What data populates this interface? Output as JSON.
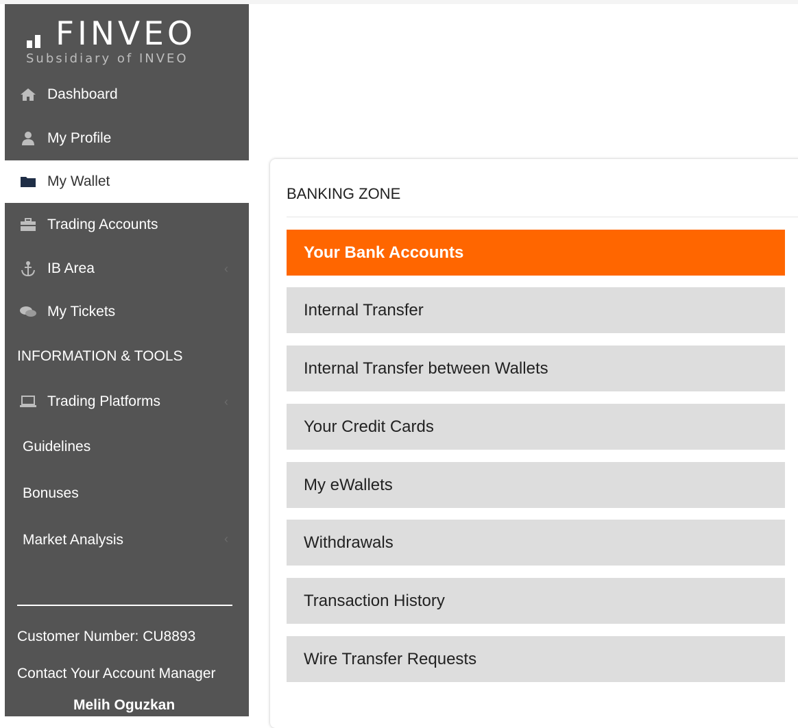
{
  "brand": {
    "name": "FINVEO",
    "tagline": "Subsidiary of INVEO"
  },
  "sidebar": {
    "items": [
      {
        "label": "Dashboard",
        "icon": "home-icon"
      },
      {
        "label": "My Profile",
        "icon": "user-icon"
      },
      {
        "label": "My Wallet",
        "icon": "folder-icon",
        "active": true
      },
      {
        "label": "Trading Accounts",
        "icon": "briefcase-icon"
      },
      {
        "label": "IB Area",
        "icon": "anchor-icon",
        "has_submenu": true
      },
      {
        "label": "My Tickets",
        "icon": "comments-icon"
      }
    ],
    "section_header": "INFORMATION & TOOLS",
    "tools": [
      {
        "label": "Trading Platforms",
        "icon": "laptop-icon",
        "has_submenu": true
      },
      {
        "label": "Guidelines"
      },
      {
        "label": "Bonuses"
      },
      {
        "label": "Market Analysis",
        "has_submenu": true
      }
    ],
    "footer": {
      "customer_number": "Customer Number: CU8893",
      "contact_label": "Contact Your Account Manager",
      "manager_name": "Melih Oguzkan"
    },
    "chevron_glyph": "‹"
  },
  "banking": {
    "title": "BANKING ZONE",
    "items": [
      {
        "label": "Your Bank Accounts",
        "selected": true
      },
      {
        "label": "Internal Transfer"
      },
      {
        "label": "Internal Transfer between Wallets"
      },
      {
        "label": "Your Credit Cards"
      },
      {
        "label": "My eWallets"
      },
      {
        "label": "Withdrawals"
      },
      {
        "label": "Transaction History"
      },
      {
        "label": "Wire Transfer Requests"
      }
    ]
  },
  "colors": {
    "sidebar_bg": "#545454",
    "accent": "#ff6600",
    "menu_bg": "#dddddd"
  }
}
